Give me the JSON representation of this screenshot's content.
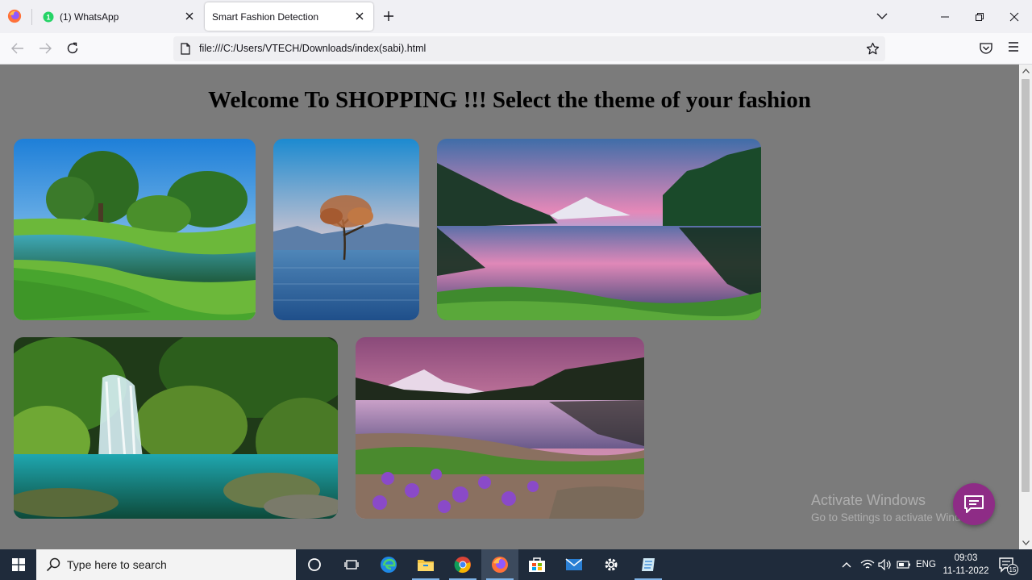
{
  "browser": {
    "tabs": [
      {
        "title": "(1) WhatsApp",
        "active": false
      },
      {
        "title": "Smart Fashion Detection",
        "active": true
      }
    ],
    "url": "file:///C:/Users/VTECH/Downloads/index(sabi).html"
  },
  "page": {
    "heading": "Welcome To SHOPPING !!! Select the theme of your fashion",
    "themes": [
      {
        "name": "meadow-river",
        "description": "green meadow with river and trees"
      },
      {
        "name": "lone-tree-lake",
        "description": "lone tree in lake with mountains"
      },
      {
        "name": "pink-sunset-lake",
        "description": "mountain lake with pink sunset reflection"
      },
      {
        "name": "forest-waterfall",
        "description": "waterfall in mossy forest"
      },
      {
        "name": "purple-flowers-lake",
        "description": "lake at dusk with purple wildflowers"
      }
    ],
    "watermark": {
      "title": "Activate Windows",
      "subtitle": "Go to Settings to activate Windows."
    }
  },
  "taskbar": {
    "search_placeholder": "Type here to search",
    "apps": [
      "task-view",
      "microsoft-edge",
      "file-explorer",
      "google-chrome",
      "firefox",
      "microsoft-store",
      "mail",
      "settings",
      "notepad-app"
    ],
    "tray_language": "ENG",
    "time": "09:03",
    "date": "11-11-2022",
    "notification_count": "15"
  },
  "colors": {
    "page_background": "#7b7b7b",
    "taskbar": "#1f2b3b",
    "chat_button": "#8e2c86"
  }
}
